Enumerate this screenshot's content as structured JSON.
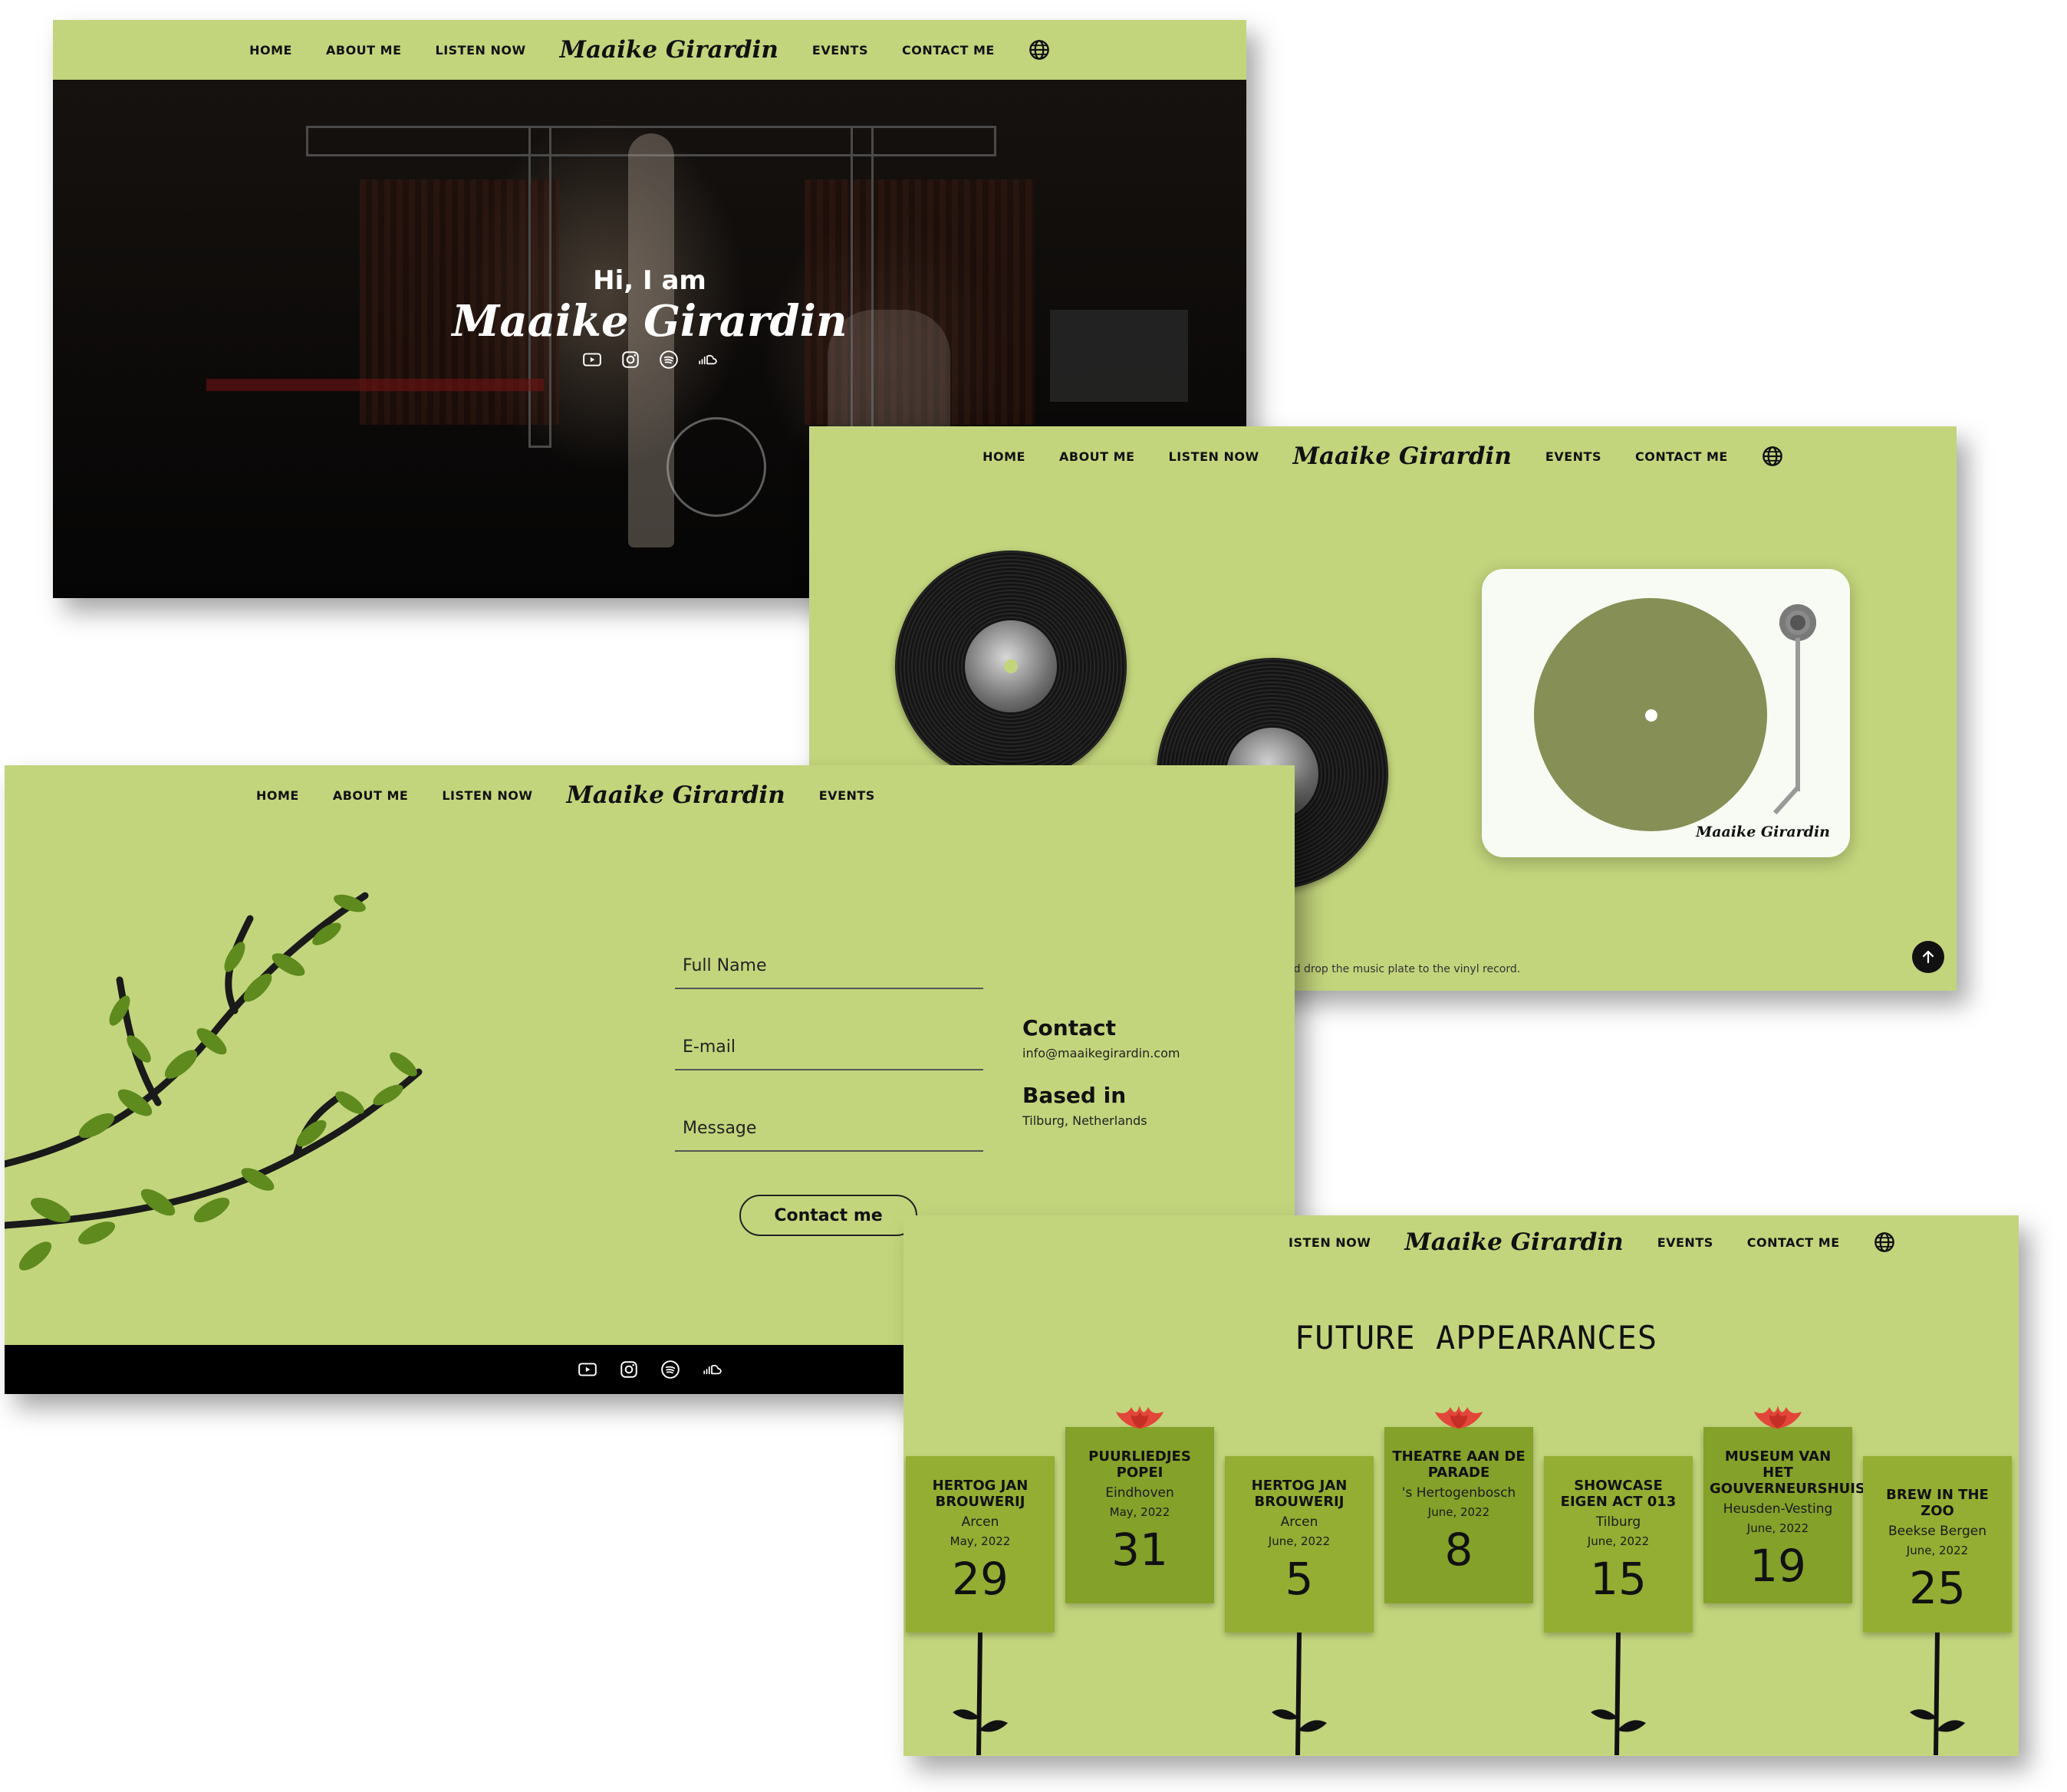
{
  "nav": {
    "home": "HOME",
    "about": "ABOUT ME",
    "listen": "LISTEN NOW",
    "brand": "Maaike Girardin",
    "events": "EVENTS",
    "contact": "CONTACT ME",
    "language_icon": "globe-icon"
  },
  "hero": {
    "subtitle": "Hi, I am",
    "title": "Maaike Girardin",
    "social_icons": [
      "youtube-icon",
      "instagram-icon",
      "spotify-icon",
      "soundcloud-icon"
    ]
  },
  "listen": {
    "player_brand": "Maaike Girardin",
    "drag_hint": "*Drag and drop the music plate to the vinyl record."
  },
  "contact": {
    "fields": {
      "name": "Full Name",
      "email": "E-mail",
      "message": "Message"
    },
    "button": "Contact me",
    "info": {
      "contact_heading": "Contact",
      "email": "info@maaikegirardin.com",
      "based_heading": "Based in",
      "location": "Tilburg, Netherlands"
    }
  },
  "events": {
    "nav_listen_partial": "ISTEN NOW",
    "title": "FUTURE APPEARANCES",
    "items": [
      {
        "venue": "HERTOG JAN BROUWERIJ",
        "city": "Arcen",
        "month": "May, 2022",
        "day": "29"
      },
      {
        "venue": "PUURLIEDJES POPEI",
        "city": "Eindhoven",
        "month": "May, 2022",
        "day": "31"
      },
      {
        "venue": "HERTOG JAN BROUWERIJ",
        "city": "Arcen",
        "month": "June, 2022",
        "day": "5"
      },
      {
        "venue": "THEATRE AAN DE PARADE",
        "city": "'s Hertogenbosch",
        "month": "June, 2022",
        "day": "8"
      },
      {
        "venue": "SHOWCASE EIGEN ACT 013",
        "city": "Tilburg",
        "month": "June, 2022",
        "day": "15"
      },
      {
        "venue": "MUSEUM VAN HET GOUVERNEURSHUIS",
        "city": "Heusden-Vesting",
        "month": "June, 2022",
        "day": "19"
      },
      {
        "venue": "BREW IN THE ZOO",
        "city": "Beekse Bergen",
        "month": "June, 2022",
        "day": "25"
      }
    ]
  },
  "colors": {
    "page_green": "#c3d57c",
    "card_green": "#93ae32",
    "card_green_dark": "#84a12a",
    "flower_red": "#e2463a",
    "black": "#111111"
  }
}
